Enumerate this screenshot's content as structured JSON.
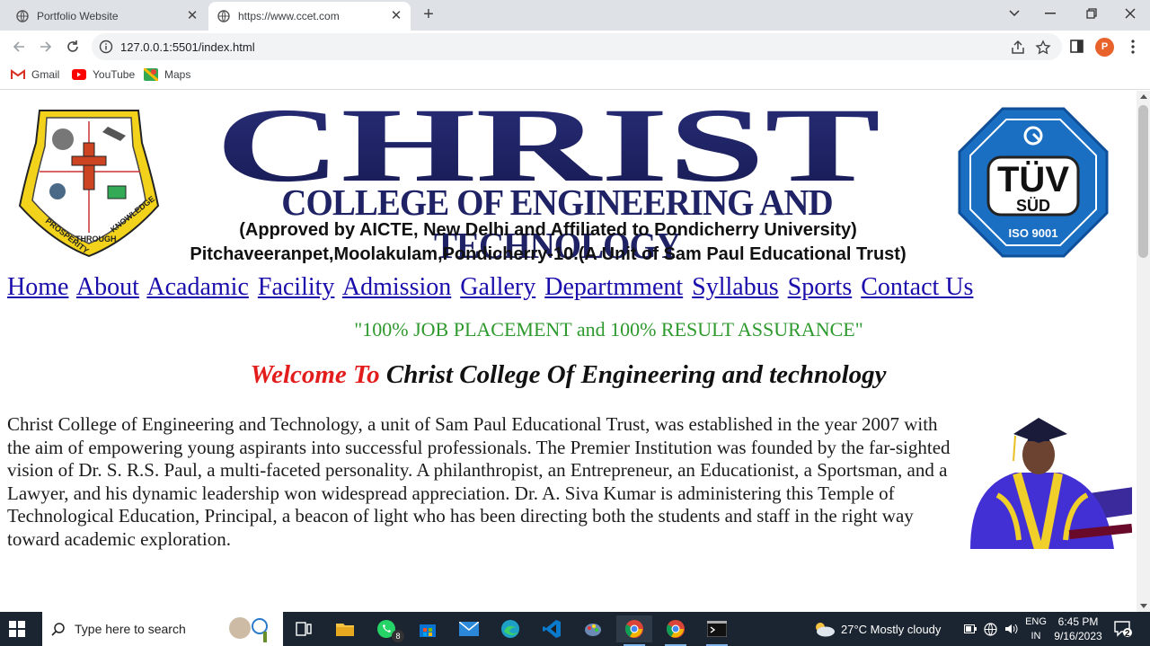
{
  "browser": {
    "tabs": [
      {
        "title": "Portfolio Website",
        "active": false
      },
      {
        "title": "https://www.ccet.com",
        "active": true
      }
    ],
    "url": "127.0.0.1:5501/index.html",
    "bookmarks": [
      "Gmail",
      "YouTube",
      "Maps"
    ],
    "profile_initial": "P"
  },
  "header": {
    "logo_text": "CHRIST",
    "college_name": "COLLEGE OF ENGINEERING AND TECHNOLOGY",
    "approval": "(Approved by AICTE, New Delhi and Affiliated to Pondicherry University)",
    "address": "Pitchaveeranpet,Moolakulam,Pondicherry-10.(A Unit of Sam Paul Educational Trust)",
    "crest_motto": [
      "PROSPERITY",
      "THROUGH",
      "KNOWLEDGE"
    ],
    "cert": {
      "brand": "TÜV",
      "sub": "SÜD",
      "standard": "ISO 9001"
    }
  },
  "nav": {
    "links": [
      "Home",
      "About",
      "Acadamic",
      "Facility",
      "Admission",
      "Gallery",
      "Departmment",
      "Syllabus",
      "Sports",
      "Contact Us"
    ]
  },
  "tagline": "\"100% JOB PLACEMENT and 100% RESULT ASSURANCE\"",
  "welcome": {
    "prefix": "Welcome To",
    "rest": "Christ College Of Engineering and technology"
  },
  "intro": "Christ College of Engineering and Technology, a unit of Sam Paul Educational Trust, was established in the year 2007 with the aim of empowering young aspirants into successful professionals. The Premier Institution was founded by the far-sighted vision of Dr. S. R.S. Paul, a multi-faceted personality. A philanthropist, an Entrepreneur, an Educationist, a Sportsman, and a Lawyer, and his dynamic leadership won widespread appreciation. Dr. A. Siva Kumar is administering this Temple of Technological Education, Principal, a beacon of light who has been directing both the students and staff in the right way toward academic exploration.",
  "taskbar": {
    "search_placeholder": "Type here to search",
    "whatsapp_badge": "8",
    "weather": "27°C  Mostly cloudy",
    "lang_line1": "ENG",
    "lang_line2": "IN",
    "time": "6:45 PM",
    "date": "9/16/2023",
    "notif_count": "2"
  },
  "colors": {
    "navy": "#1f2366",
    "welcome_red": "#e31c1c",
    "tagline_green": "#2e9a2e",
    "link_blue": "#1a0dab"
  }
}
